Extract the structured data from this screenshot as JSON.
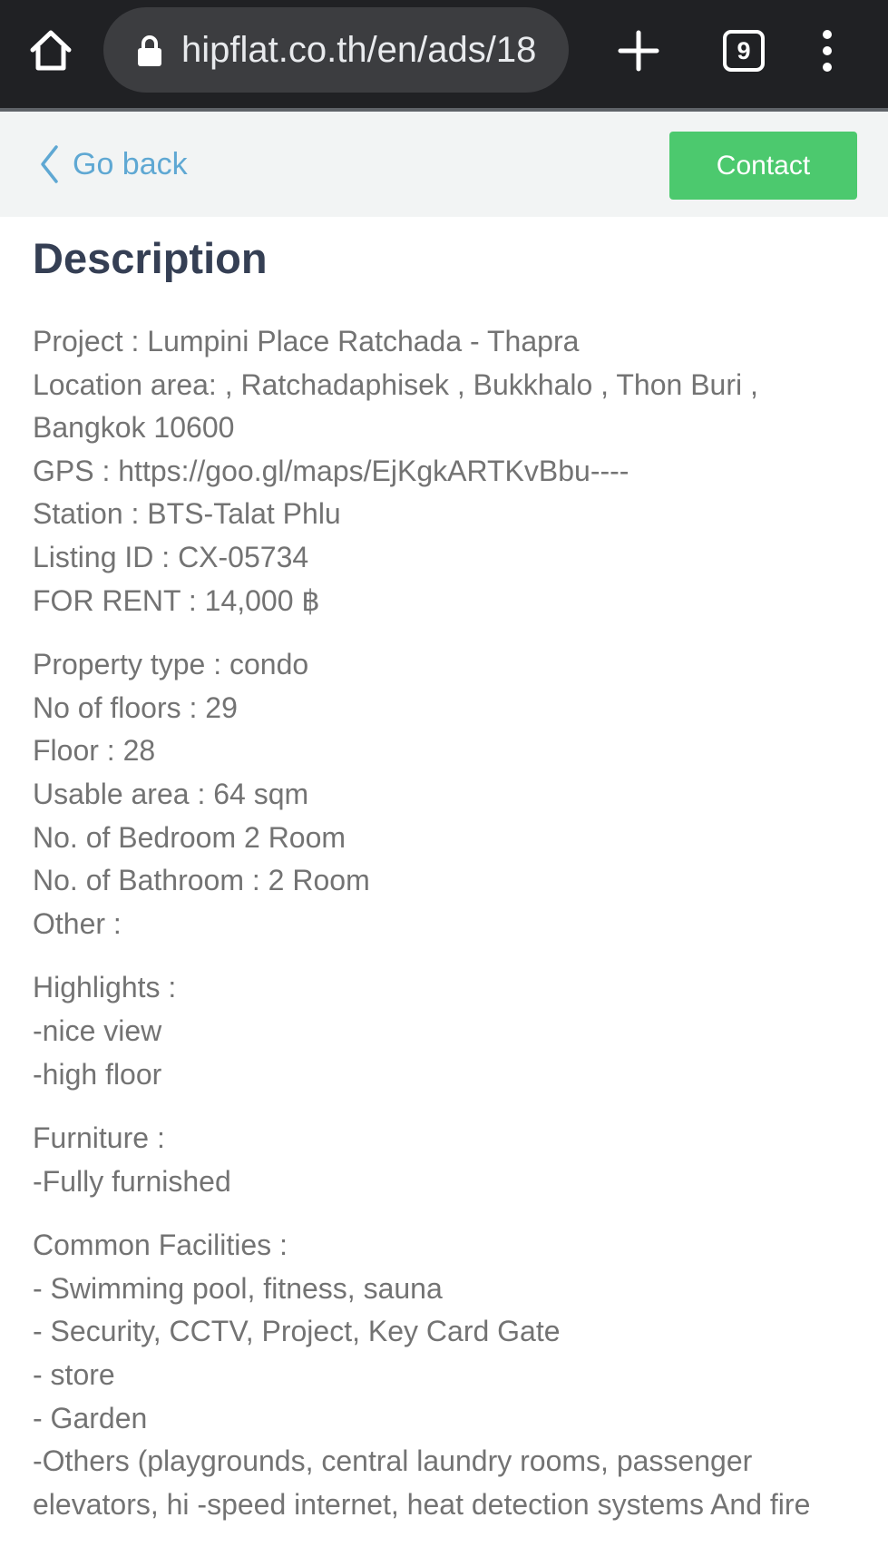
{
  "browser": {
    "url": "hipflat.co.th/en/ads/18",
    "tab_count": "9"
  },
  "header": {
    "back_label": "Go back",
    "contact_label": "Contact"
  },
  "description": {
    "title": "Description",
    "paragraphs": [
      [
        "Project : Lumpini Place Ratchada - Thapra",
        "Location area: , Ratchadaphisek , Bukkhalo , Thon Buri ,",
        "Bangkok 10600",
        "GPS : https://goo.gl/maps/EjKgkARTKvBbu----",
        "Station : BTS-Talat Phlu",
        "Listing ID : CX-05734",
        "FOR RENT : 14,000 ฿"
      ],
      [
        "Property type : condo",
        "No of floors : 29",
        "Floor : 28",
        "Usable area : 64 sqm",
        "No. of Bedroom 2 Room",
        "No. of Bathroom : 2 Room",
        "Other :"
      ],
      [
        "Highlights :",
        "-nice view",
        "-high floor"
      ],
      [
        "Furniture :",
        "-Fully furnished"
      ],
      [
        "Common Facilities :",
        "- Swimming pool, fitness, sauna",
        "- Security, CCTV, Project, Key Card Gate",
        "- store",
        "- Garden",
        "-Others (playgrounds, central laundry rooms, passenger",
        "elevators, hi -speed internet, heat detection systems And fire"
      ]
    ]
  },
  "colors": {
    "chrome_bg": "#202124",
    "header_bg": "#f2f4f4",
    "link_blue": "#5fa8d3",
    "contact_green": "#4cc96e",
    "title_color": "#353f54",
    "body_text": "#737373"
  },
  "icons": {
    "home": "home-icon",
    "lock": "lock-icon",
    "new_tab": "plus-icon",
    "tabs": "tab-switcher-icon",
    "menu": "kebab-menu-icon",
    "back": "chevron-left-icon"
  }
}
